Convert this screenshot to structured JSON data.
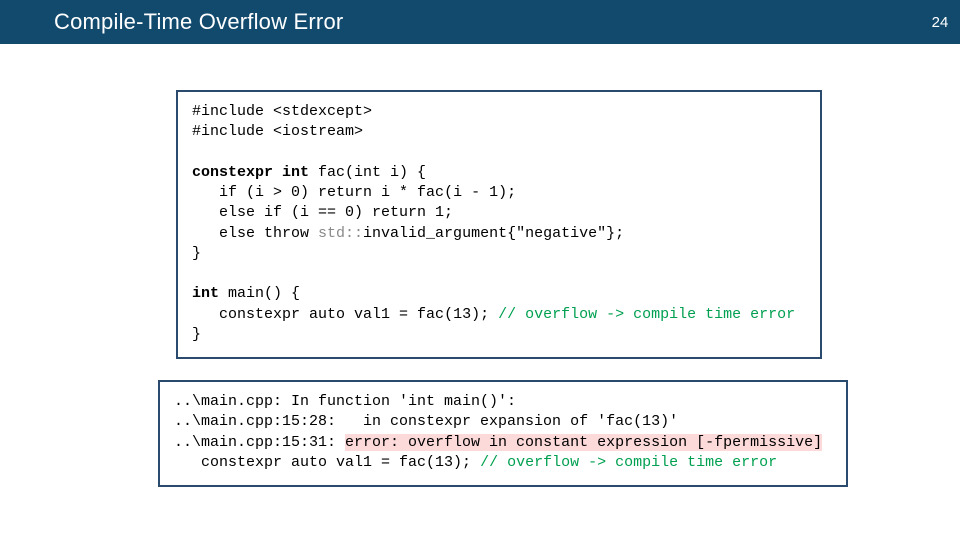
{
  "page": {
    "number": "24"
  },
  "title": "Compile-Time Overflow Error",
  "code": {
    "inc1": "#include <stdexcept>",
    "inc2": "#include <iostream>",
    "fac_sig_pre": "constexpr int ",
    "fac_sig_name": "fac",
    "fac_sig_post": "(int i) {",
    "fac_l1_pre": "   if (i > 0) return i * ",
    "fac_l1_call": "fac",
    "fac_l1_post": "(i - 1);",
    "fac_l2": "   else if (i == 0) return 1;",
    "fac_l3_pre": "   else throw ",
    "fac_l3_grey": "std::",
    "fac_l3_post": "invalid_argument{\"negative\"};",
    "fac_close": "}",
    "main_sig_pre": "int ",
    "main_sig_name": "main",
    "main_sig_post": "() {",
    "main_l1_pre": "   constexpr auto val1 = ",
    "main_l1_call": "fac",
    "main_l1_post": "(13); ",
    "main_l1_comment": "// overflow -> compile time error",
    "main_close": "}"
  },
  "output": {
    "l1": "..\\main.cpp: In function 'int main()':",
    "l2": "..\\main.cpp:15:28:   in constexpr expansion of 'fac(13)'",
    "l3_pre": "..\\main.cpp:15:31: ",
    "l3_err": "error: overflow in constant expression [-fpermissive]",
    "l4_pre": "   constexpr auto val1 = fac(13); ",
    "l4_comment": "// overflow -> compile time error"
  }
}
